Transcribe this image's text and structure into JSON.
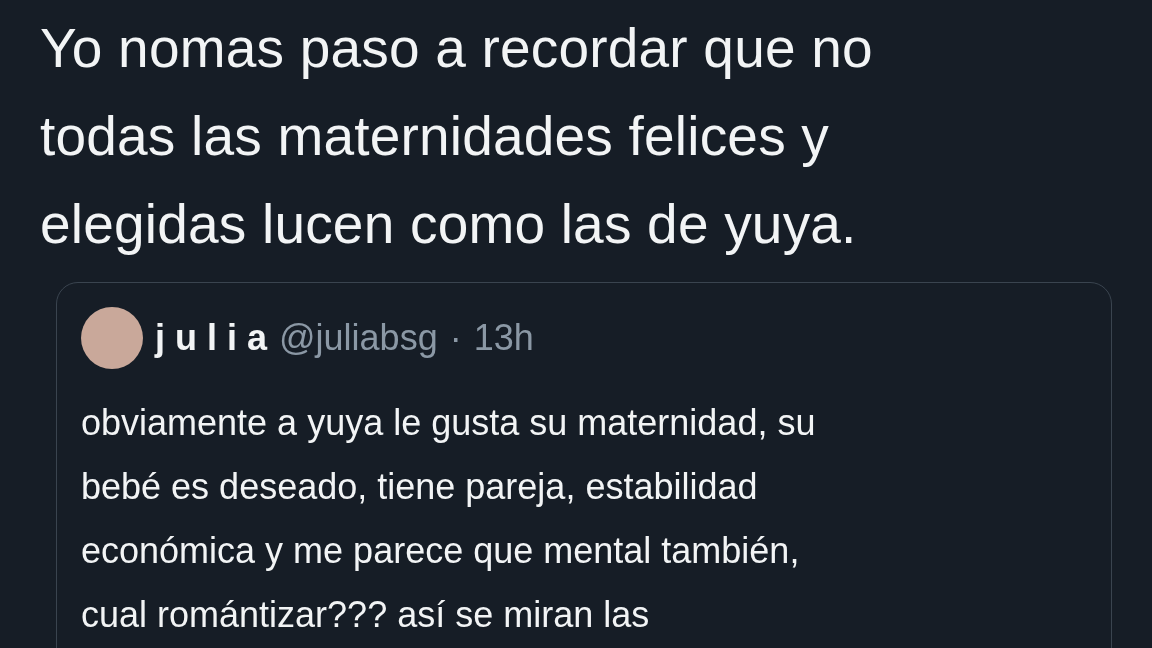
{
  "tweet": {
    "text": "Yo nomas paso a recordar que no\ntodas las maternidades felices y\nelegidas lucen como las de yuya.",
    "quoted": {
      "name": "j u l i a",
      "handle": "@juliabsg",
      "separator": "·",
      "time": "13h",
      "text": "obviamente a yuya le gusta su maternidad, su\nbebé es deseado, tiene pareja, estabilidad\neconómica y me parece que mental también,\ncual romántizar??? así se miran las"
    }
  }
}
